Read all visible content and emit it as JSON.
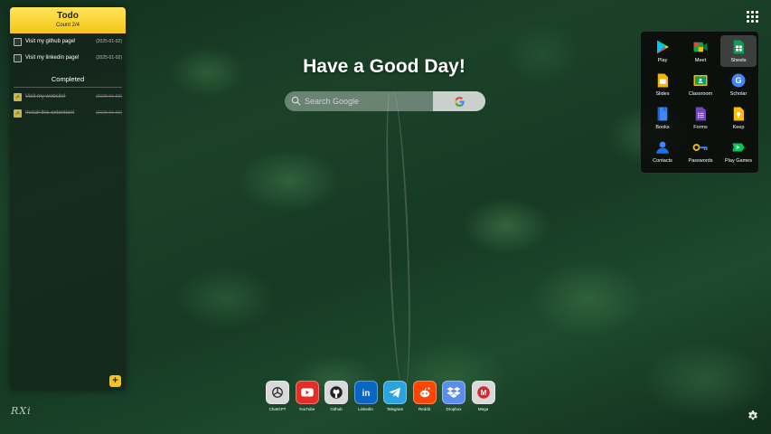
{
  "todo": {
    "title": "Todo",
    "count": "Count 2/4",
    "items": [
      {
        "label": "Visit my github page!",
        "date": "(2025-01-02)"
      },
      {
        "label": "Visit my linkedin page!",
        "date": "(2025-01-02)"
      }
    ],
    "completed_heading": "Completed",
    "completed": [
      {
        "label": "Visit my website!",
        "date": "(2025-01-02)"
      },
      {
        "label": "Install this extention!",
        "date": "(2025-01-02)"
      }
    ],
    "add_label": "+"
  },
  "greeting": "Have a Good Day!",
  "search": {
    "placeholder": "Search Google"
  },
  "signature": "RXi",
  "google_apps": [
    {
      "label": "Play",
      "icon": "play-icon"
    },
    {
      "label": "Meet",
      "icon": "meet-icon"
    },
    {
      "label": "Sheets",
      "icon": "sheets-icon"
    },
    {
      "label": "Slides",
      "icon": "slides-icon"
    },
    {
      "label": "Classroom",
      "icon": "classroom-icon"
    },
    {
      "label": "Scholar",
      "icon": "scholar-icon"
    },
    {
      "label": "Books",
      "icon": "books-icon"
    },
    {
      "label": "Forms",
      "icon": "forms-icon"
    },
    {
      "label": "Keep",
      "icon": "keep-icon"
    },
    {
      "label": "Contacts",
      "icon": "contacts-icon"
    },
    {
      "label": "Passwords",
      "icon": "passwords-icon"
    },
    {
      "label": "Play Games",
      "icon": "play-games-icon"
    }
  ],
  "dock": [
    {
      "label": "ChatGPT",
      "icon": "chatgpt-icon",
      "color": "#d9d9d9"
    },
    {
      "label": "YouTube",
      "icon": "youtube-icon",
      "color": "#ff0000"
    },
    {
      "label": "Github",
      "icon": "github-icon",
      "color": "#d9d9d9"
    },
    {
      "label": "Linkedin",
      "icon": "linkedin-icon",
      "color": "#0a66c2"
    },
    {
      "label": "Telegram",
      "icon": "telegram-icon",
      "color": "#2aa3df"
    },
    {
      "label": "Reddit",
      "icon": "reddit-icon",
      "color": "#ff4500"
    },
    {
      "label": "Dropbox",
      "icon": "dropbox-icon",
      "color": "#0061ff"
    },
    {
      "label": "Mega",
      "icon": "mega-icon",
      "color": "#d9272e"
    }
  ],
  "colors": {
    "todo_accent": "#f5c518"
  }
}
